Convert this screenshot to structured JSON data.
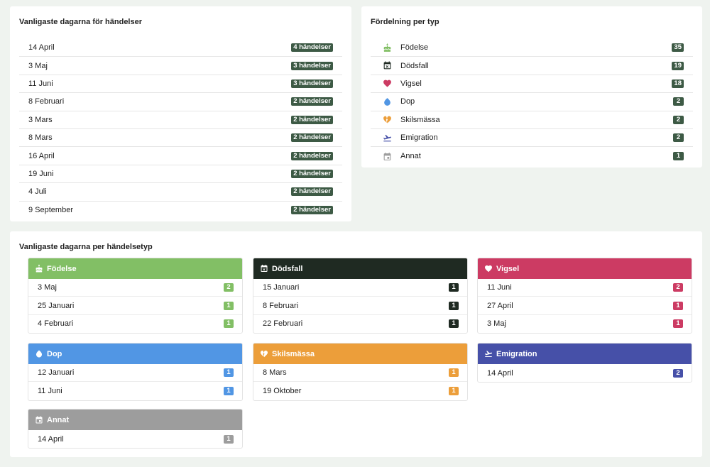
{
  "common_days": {
    "title": "Vanligaste dagarna för händelser",
    "rows": [
      {
        "date": "14 April",
        "count": "4 händelser"
      },
      {
        "date": "3 Maj",
        "count": "3 händelser"
      },
      {
        "date": "11 Juni",
        "count": "3 händelser"
      },
      {
        "date": "8 Februari",
        "count": "2 händelser"
      },
      {
        "date": "3 Mars",
        "count": "2 händelser"
      },
      {
        "date": "8 Mars",
        "count": "2 händelser"
      },
      {
        "date": "16 April",
        "count": "2 händelser"
      },
      {
        "date": "19 Juni",
        "count": "2 händelser"
      },
      {
        "date": "4 Juli",
        "count": "2 händelser"
      },
      {
        "date": "9 September",
        "count": "2 händelser"
      }
    ]
  },
  "distribution": {
    "title": "Fördelning per typ",
    "rows": [
      {
        "icon": "cake-icon",
        "label": "Födelse",
        "count": "35"
      },
      {
        "icon": "calendar-x-icon",
        "label": "Dödsfall",
        "count": "19"
      },
      {
        "icon": "heart-icon",
        "label": "Vigsel",
        "count": "18"
      },
      {
        "icon": "water-drop-icon",
        "label": "Dop",
        "count": "2"
      },
      {
        "icon": "broken-heart-icon",
        "label": "Skilsmässa",
        "count": "2"
      },
      {
        "icon": "plane-departure-icon",
        "label": "Emigration",
        "count": "2"
      },
      {
        "icon": "calendar-icon",
        "label": "Annat",
        "count": "1"
      }
    ]
  },
  "per_type": {
    "title": "Vanligaste dagarna per händelsetyp",
    "types": [
      {
        "name": "Födelse",
        "icon": "cake-icon",
        "color": "#82bf65",
        "rows": [
          {
            "date": "3 Maj",
            "count": "2"
          },
          {
            "date": "25 Januari",
            "count": "1"
          },
          {
            "date": "4 Februari",
            "count": "1"
          }
        ]
      },
      {
        "name": "Dödsfall",
        "icon": "calendar-x-icon",
        "color": "#1f2a22",
        "rows": [
          {
            "date": "15 Januari",
            "count": "1"
          },
          {
            "date": "8 Februari",
            "count": "1"
          },
          {
            "date": "22 Februari",
            "count": "1"
          }
        ]
      },
      {
        "name": "Vigsel",
        "icon": "heart-icon",
        "color": "#cc3b63",
        "rows": [
          {
            "date": "11 Juni",
            "count": "2"
          },
          {
            "date": "27 April",
            "count": "1"
          },
          {
            "date": "3 Maj",
            "count": "1"
          }
        ]
      },
      {
        "name": "Dop",
        "icon": "water-drop-icon",
        "color": "#5196e4",
        "rows": [
          {
            "date": "12 Januari",
            "count": "1"
          },
          {
            "date": "11 Juni",
            "count": "1"
          }
        ]
      },
      {
        "name": "Skilsmässa",
        "icon": "broken-heart-icon",
        "color": "#ec9e3a",
        "rows": [
          {
            "date": "8 Mars",
            "count": "1"
          },
          {
            "date": "19 Oktober",
            "count": "1"
          }
        ]
      },
      {
        "name": "Emigration",
        "icon": "plane-departure-icon",
        "color": "#4650a8",
        "rows": [
          {
            "date": "14 April",
            "count": "2"
          }
        ]
      },
      {
        "name": "Annat",
        "icon": "calendar-icon",
        "color": "#9d9d9d",
        "rows": [
          {
            "date": "14 April",
            "count": "1"
          }
        ]
      }
    ]
  }
}
